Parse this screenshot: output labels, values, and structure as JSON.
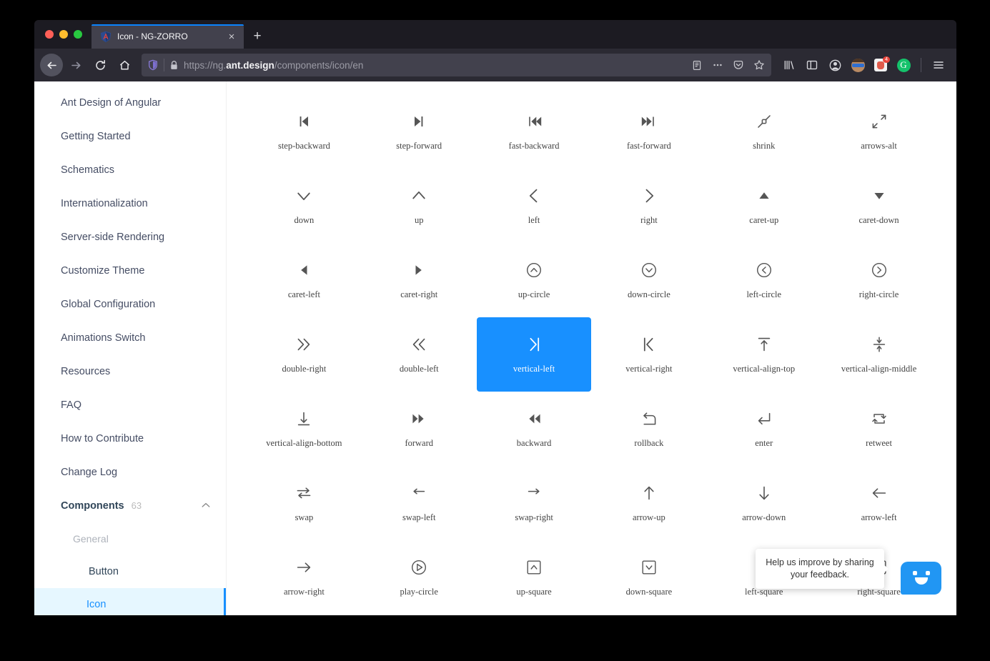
{
  "browser": {
    "tab": {
      "title": "Icon - NG-ZORRO",
      "favicon": "angular-shield-icon",
      "close_label": "×"
    },
    "new_tab_label": "+",
    "nav": {
      "back": "back-arrow-icon",
      "forward": "forward-arrow-icon",
      "reload": "reload-icon",
      "home": "home-icon"
    },
    "url": {
      "scheme": "https://",
      "host_prefix": "ng.",
      "host_strong": "ant.design",
      "path": "/components/icon/en",
      "full": "https://ng.ant.design/components/icon/en",
      "shield": "tracking-protection-icon",
      "lock": "padlock-icon",
      "reader": "reader-view-icon"
    },
    "toolbar_right": {
      "page_actions": "ellipsis-icon",
      "pocket": "pocket-icon",
      "bookmark": "star-icon",
      "library": "library-icon",
      "sidebars": "sidebar-icon",
      "account": "account-icon",
      "profile_avatar": "avatar-icon",
      "extension_badge_count": "4",
      "grammarly": "G",
      "menu": "hamburger-menu-icon"
    }
  },
  "sidebar": {
    "items": [
      {
        "label": "Ant Design of Angular",
        "type": "link"
      },
      {
        "label": "Getting Started",
        "type": "link"
      },
      {
        "label": "Schematics",
        "type": "link"
      },
      {
        "label": "Internationalization",
        "type": "link"
      },
      {
        "label": "Server-side Rendering",
        "type": "link"
      },
      {
        "label": "Customize Theme",
        "type": "link"
      },
      {
        "label": "Global Configuration",
        "type": "link"
      },
      {
        "label": "Animations Switch",
        "type": "link"
      },
      {
        "label": "Resources",
        "type": "link"
      },
      {
        "label": "FAQ",
        "type": "link"
      },
      {
        "label": "How to Contribute",
        "type": "link"
      },
      {
        "label": "Change Log",
        "type": "link"
      }
    ],
    "components_group": {
      "label": "Components",
      "count": "63",
      "chevron": "chevron-up-icon",
      "expanded": true
    },
    "subheader": "General",
    "children": [
      {
        "label": "Button",
        "active": false
      },
      {
        "label": "Icon",
        "active": true
      }
    ],
    "accent_color": "#1890ff",
    "active_background": "#e6f7ff"
  },
  "icon_grid": {
    "selected": "vertical-left",
    "selected_color": "#1890ff",
    "icons": [
      {
        "name": "step-backward",
        "glyph": "step-backward"
      },
      {
        "name": "step-forward",
        "glyph": "step-forward"
      },
      {
        "name": "fast-backward",
        "glyph": "fast-backward"
      },
      {
        "name": "fast-forward",
        "glyph": "fast-forward"
      },
      {
        "name": "shrink",
        "glyph": "shrink"
      },
      {
        "name": "arrows-alt",
        "glyph": "arrows-alt"
      },
      {
        "name": "down",
        "glyph": "down"
      },
      {
        "name": "up",
        "glyph": "up"
      },
      {
        "name": "left",
        "glyph": "left"
      },
      {
        "name": "right",
        "glyph": "right"
      },
      {
        "name": "caret-up",
        "glyph": "caret-up"
      },
      {
        "name": "caret-down",
        "glyph": "caret-down"
      },
      {
        "name": "caret-left",
        "glyph": "caret-left"
      },
      {
        "name": "caret-right",
        "glyph": "caret-right"
      },
      {
        "name": "up-circle",
        "glyph": "up-circle"
      },
      {
        "name": "down-circle",
        "glyph": "down-circle"
      },
      {
        "name": "left-circle",
        "glyph": "left-circle"
      },
      {
        "name": "right-circle",
        "glyph": "right-circle"
      },
      {
        "name": "double-right",
        "glyph": "double-right"
      },
      {
        "name": "double-left",
        "glyph": "double-left"
      },
      {
        "name": "vertical-left",
        "glyph": "vertical-left"
      },
      {
        "name": "vertical-right",
        "glyph": "vertical-right"
      },
      {
        "name": "vertical-align-top",
        "glyph": "vertical-align-top"
      },
      {
        "name": "vertical-align-middle",
        "glyph": "vertical-align-middle"
      },
      {
        "name": "vertical-align-bottom",
        "glyph": "vertical-align-bottom"
      },
      {
        "name": "forward",
        "glyph": "forward"
      },
      {
        "name": "backward",
        "glyph": "backward"
      },
      {
        "name": "rollback",
        "glyph": "rollback"
      },
      {
        "name": "enter",
        "glyph": "enter"
      },
      {
        "name": "retweet",
        "glyph": "retweet"
      },
      {
        "name": "swap",
        "glyph": "swap"
      },
      {
        "name": "swap-left",
        "glyph": "swap-left"
      },
      {
        "name": "swap-right",
        "glyph": "swap-right"
      },
      {
        "name": "arrow-up",
        "glyph": "arrow-up"
      },
      {
        "name": "arrow-down",
        "glyph": "arrow-down"
      },
      {
        "name": "arrow-left",
        "glyph": "arrow-left"
      },
      {
        "name": "arrow-right",
        "glyph": "arrow-right"
      },
      {
        "name": "play-circle",
        "glyph": "play-circle"
      },
      {
        "name": "up-square",
        "glyph": "up-square"
      },
      {
        "name": "down-square",
        "glyph": "down-square"
      },
      {
        "name": "left-square",
        "glyph": "left-square"
      },
      {
        "name": "right-square",
        "glyph": "right-square"
      }
    ]
  },
  "feedback": {
    "tooltip_text": "Help us improve by sharing your feedback.",
    "button_icon": "chat-smiley-icon",
    "button_color": "#2196f3"
  }
}
